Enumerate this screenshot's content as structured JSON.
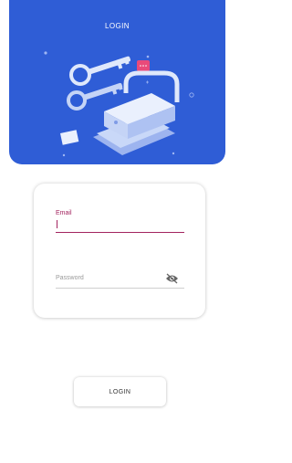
{
  "header": {
    "title": "LOGIN",
    "background_color": "#2f5dd6"
  },
  "illustration": {
    "icons": [
      "key-icon",
      "key-icon",
      "padlock-icon",
      "message-bubble-icon",
      "card-icon"
    ]
  },
  "form": {
    "email_label": "Email",
    "email_value": "",
    "password_placeholder": "Password",
    "password_visibility_icon": "eye-off-icon",
    "accent_color": "#a3245f"
  },
  "actions": {
    "login_label": "LOGIN"
  }
}
